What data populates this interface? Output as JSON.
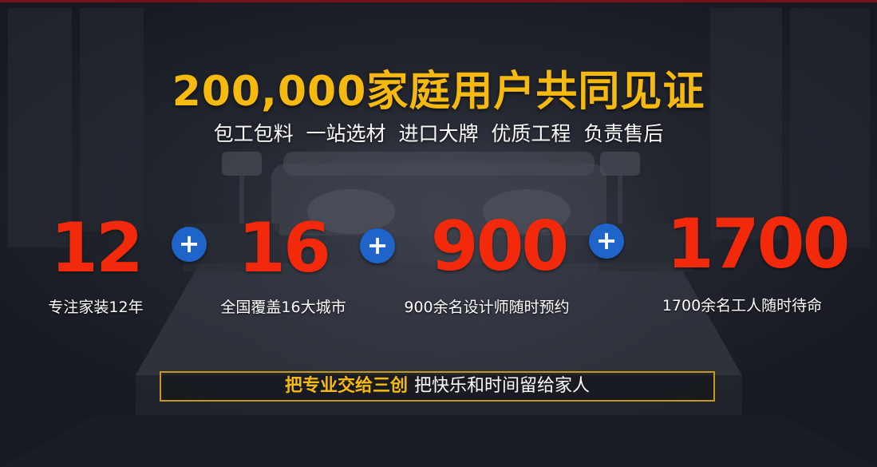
{
  "headline": "200,000家庭用户共同见证",
  "subline": "包工包料  一站选材  进口大牌  优质工程  负责售后",
  "stats": [
    {
      "number": "12",
      "caption": "专注家装12年"
    },
    {
      "number": "16",
      "caption": "全国覆盖16大城市"
    },
    {
      "number": "900",
      "caption": "900余名设计师随时预约"
    },
    {
      "number": "1700",
      "caption": "1700余名工人随时待命"
    }
  ],
  "plus_symbol": "+",
  "slogan": {
    "strong": "把专业交给三创",
    "rest": "把快乐和时间留给家人"
  },
  "colors": {
    "headline": "#f6b90f",
    "numbers": "#f22a0b",
    "plus_badge": "#1f64c9",
    "slogan_border": "#c49a1c",
    "top_border": "#b0151b"
  }
}
